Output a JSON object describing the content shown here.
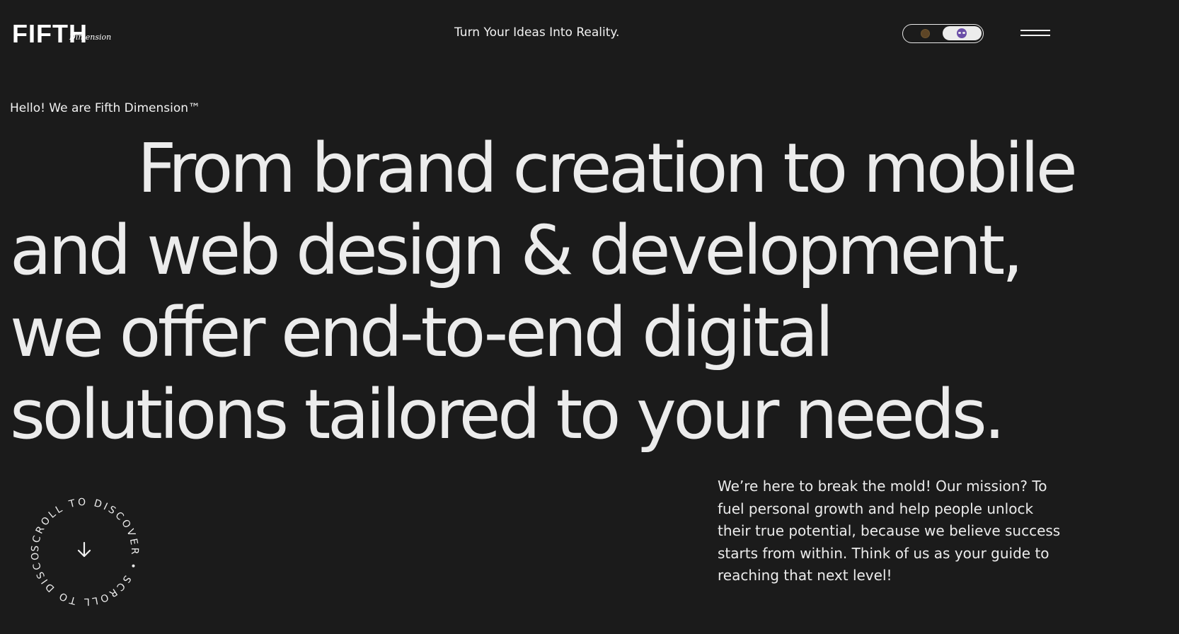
{
  "header": {
    "logo_text": "FIFTH",
    "logo_script": "Dimension",
    "tagline": "Turn Your Ideas Into Reality."
  },
  "theme_toggle": {
    "icons": [
      "sun-icon",
      "moon-icon"
    ],
    "selected": "dark"
  },
  "menu": {
    "icon": "hamburger-menu-icon"
  },
  "intro": "Hello! We are Fifth Dimension™",
  "hero": {
    "line1": "From brand creation to mobile",
    "line2": "and web design & development,",
    "line3": "we offer end-to-end digital",
    "line4": "solutions tailored to your needs."
  },
  "mission": "We’re here to break the mold! Our mission? To fuel personal growth and help people unlock their true potential, because we believe success starts from within. Think of us as your guide to reaching that next level!",
  "scroll_badge": {
    "text": "SCROLL TO DISCOVER • SCROLL TO DISCOVER •",
    "icon": "arrow-down-icon"
  },
  "colors": {
    "background": "#1b1b1b",
    "text": "#ececec",
    "moon_accent": "#6b4ea8",
    "sun_accent": "#5d4526"
  }
}
